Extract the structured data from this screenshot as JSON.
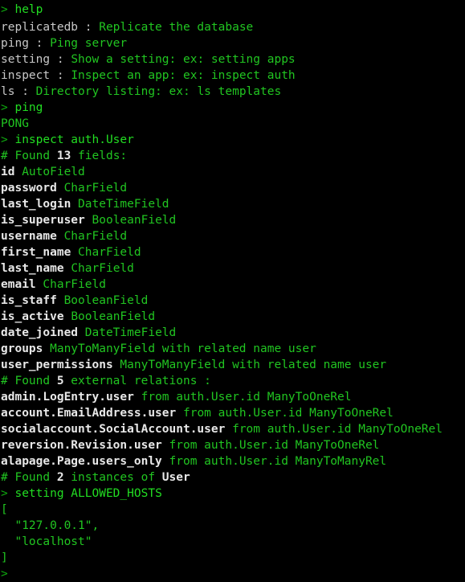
{
  "terminal": {
    "title": "django shell terminal session",
    "prompt_symbol": ">",
    "colors": {
      "background": "#000000",
      "prompt": "#0fa80f",
      "command": "#22dd22",
      "output_green": "#21c521",
      "output_white": "#e8e8e8",
      "help_name": "#c8c8c8"
    },
    "lines": [
      {
        "id": "l01",
        "type": "prompt",
        "sym": ">",
        "text": "help"
      },
      {
        "id": "l02",
        "type": "help",
        "name": "replicatedb :",
        "desc": "Replicate the database"
      },
      {
        "id": "l03",
        "type": "help",
        "name": "ping :",
        "desc": "Ping server"
      },
      {
        "id": "l04",
        "type": "help",
        "name": "setting :",
        "desc": "Show a setting: ex: setting apps"
      },
      {
        "id": "l05",
        "type": "help",
        "name": "inspect :",
        "desc": "Inspect an app: ex: inspect auth"
      },
      {
        "id": "l06",
        "type": "help",
        "name": "ls :",
        "desc": "Directory listing: ex: ls templates"
      },
      {
        "id": "l07",
        "type": "prompt",
        "sym": ">",
        "text": "ping"
      },
      {
        "id": "l08",
        "type": "output",
        "text": "PONG"
      },
      {
        "id": "l09",
        "type": "prompt",
        "sym": ">",
        "text": "inspect auth.User"
      },
      {
        "id": "l10",
        "type": "found",
        "pre": "# Found ",
        "num": "13",
        "post": " fields:"
      },
      {
        "id": "l11",
        "type": "field",
        "name": "id",
        "ftype": "AutoField"
      },
      {
        "id": "l12",
        "type": "field",
        "name": "password",
        "ftype": "CharField"
      },
      {
        "id": "l13",
        "type": "field",
        "name": "last_login",
        "ftype": "DateTimeField"
      },
      {
        "id": "l14",
        "type": "field",
        "name": "is_superuser",
        "ftype": "BooleanField"
      },
      {
        "id": "l15",
        "type": "field",
        "name": "username",
        "ftype": "CharField"
      },
      {
        "id": "l16",
        "type": "field",
        "name": "first_name",
        "ftype": "CharField"
      },
      {
        "id": "l17",
        "type": "field",
        "name": "last_name",
        "ftype": "CharField"
      },
      {
        "id": "l18",
        "type": "field",
        "name": "email",
        "ftype": "CharField"
      },
      {
        "id": "l19",
        "type": "field",
        "name": "is_staff",
        "ftype": "BooleanField"
      },
      {
        "id": "l20",
        "type": "field",
        "name": "is_active",
        "ftype": "BooleanField"
      },
      {
        "id": "l21",
        "type": "field",
        "name": "date_joined",
        "ftype": "DateTimeField"
      },
      {
        "id": "l22",
        "type": "field",
        "name": "groups",
        "ftype": "ManyToManyField with related name user"
      },
      {
        "id": "l23",
        "type": "field",
        "name": "user_permissions",
        "ftype": "ManyToManyField with related name user"
      },
      {
        "id": "l24",
        "type": "found",
        "pre": "# Found ",
        "num": "5",
        "post": " external relations :"
      },
      {
        "id": "l25",
        "type": "rel",
        "name": "admin.LogEntry.user",
        "desc": "from auth.User.id ManyToOneRel"
      },
      {
        "id": "l26",
        "type": "rel",
        "name": "account.EmailAddress.user",
        "desc": "from auth.User.id ManyToOneRel"
      },
      {
        "id": "l27",
        "type": "rel",
        "name": "socialaccount.SocialAccount.user",
        "desc": "from auth.User.id ManyToOneRel"
      },
      {
        "id": "l28",
        "type": "rel",
        "name": "reversion.Revision.user",
        "desc": "from auth.User.id ManyToOneRel"
      },
      {
        "id": "l29",
        "type": "rel",
        "name": "alapage.Page.users_only",
        "desc": "from auth.User.id ManyToManyRel"
      },
      {
        "id": "l30",
        "type": "found2",
        "pre": "# Found ",
        "num": "2",
        "mid": " instances of ",
        "model": "User"
      },
      {
        "id": "l31",
        "type": "prompt",
        "sym": ">",
        "text": "setting ALLOWED_HOSTS"
      },
      {
        "id": "l32",
        "type": "output",
        "text": "["
      },
      {
        "id": "l33",
        "type": "output",
        "text": "  \"127.0.0.1\","
      },
      {
        "id": "l34",
        "type": "output",
        "text": "  \"localhost\""
      },
      {
        "id": "l35",
        "type": "output",
        "text": "]"
      },
      {
        "id": "l36",
        "type": "prompt",
        "sym": ">",
        "text": ""
      }
    ]
  }
}
